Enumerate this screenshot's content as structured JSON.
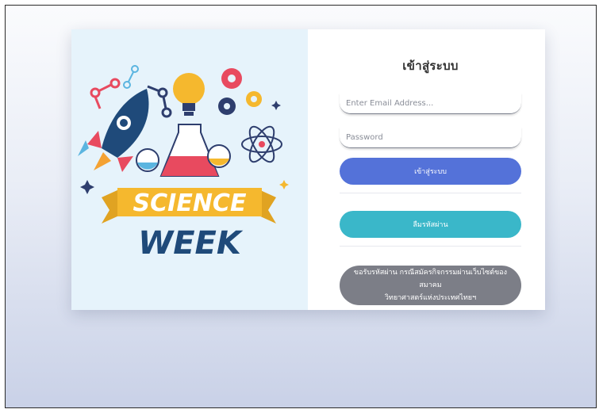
{
  "banner": {
    "line1": "SCIENCE",
    "line2": "WEEK"
  },
  "login": {
    "title": "เข้าสู่ระบบ",
    "email_placeholder": "Enter Email Address...",
    "password_placeholder": "Password",
    "login_button": "เข้าสู่ระบบ",
    "forgot_button": "ลืมรหัสผ่าน",
    "request_button_line1": "ขอรับรหัสผ่าน กรณีสมัครกิจกรรมผ่านเว็บไซต์ของสมาคม",
    "request_button_line2": "วิทยาศาสตร์แห่งประเทศไทยฯ"
  },
  "colors": {
    "primary": "#5472d9",
    "teal": "#3ab7c9",
    "gray": "#7c7e87",
    "banner_bg": "#e6f3fb"
  }
}
